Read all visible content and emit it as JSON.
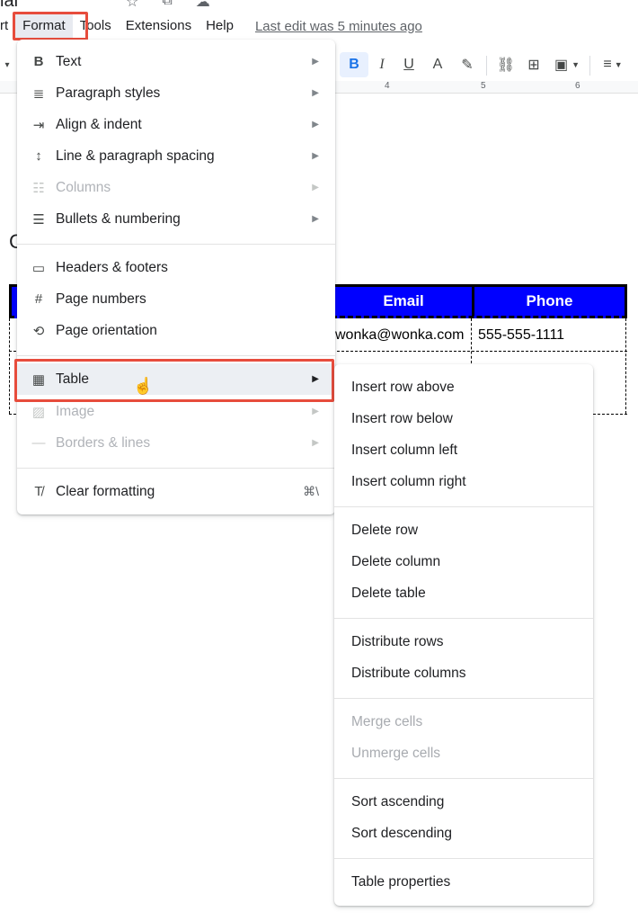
{
  "window": {
    "title_fragment": "ial",
    "title_icons": [
      "star-icon",
      "move-to-folder-icon",
      "cloud-status-icon"
    ]
  },
  "menubar": {
    "items": [
      {
        "label": "rt"
      },
      {
        "label": "Format"
      },
      {
        "label": "Tools"
      },
      {
        "label": "Extensions"
      },
      {
        "label": "Help"
      }
    ],
    "last_edit": "Last edit was 5 minutes ago"
  },
  "toolbar": {
    "bold": "B",
    "italic": "I",
    "underline": "U",
    "text_color": "A",
    "highlight": "✎",
    "link": "⛓",
    "comment": "⊞",
    "image": "▣",
    "align": "≡"
  },
  "ruler": {
    "marks": [
      "4",
      "5",
      "6"
    ]
  },
  "document": {
    "heading_fragment": "C",
    "table": {
      "headers": [
        "Email",
        "Phone"
      ],
      "rows": [
        [
          "wonka@wonka.com",
          "555-555-1111"
        ],
        [
          "",
          ""
        ]
      ]
    }
  },
  "format_menu": {
    "items": [
      {
        "label": "Text",
        "icon": "B",
        "submenu": true,
        "disabled": false
      },
      {
        "label": "Paragraph styles",
        "icon": "≣",
        "submenu": true,
        "disabled": false
      },
      {
        "label": "Align & indent",
        "icon": "⇥",
        "submenu": true,
        "disabled": false
      },
      {
        "label": "Line & paragraph spacing",
        "icon": "↕",
        "submenu": true,
        "disabled": false
      },
      {
        "label": "Columns",
        "icon": "☷",
        "submenu": true,
        "disabled": true
      },
      {
        "label": "Bullets & numbering",
        "icon": "☰",
        "submenu": true,
        "disabled": false
      },
      {
        "label": "Headers & footers",
        "icon": "▭",
        "submenu": false,
        "disabled": false
      },
      {
        "label": "Page numbers",
        "icon": "#",
        "submenu": false,
        "disabled": false
      },
      {
        "label": "Page orientation",
        "icon": "⟲",
        "submenu": false,
        "disabled": false
      },
      {
        "label": "Table",
        "icon": "▦",
        "submenu": true,
        "disabled": false,
        "active": true
      },
      {
        "label": "Image",
        "icon": "▨",
        "submenu": true,
        "disabled": true
      },
      {
        "label": "Borders & lines",
        "icon": "—",
        "submenu": true,
        "disabled": true
      },
      {
        "label": "Clear formatting",
        "icon": "T̸",
        "shortcut": "⌘\\",
        "disabled": false
      }
    ],
    "submenu_arrow": "▶"
  },
  "table_submenu": {
    "items": [
      {
        "label": "Insert row above",
        "disabled": false
      },
      {
        "label": "Insert row below",
        "disabled": false
      },
      {
        "label": "Insert column left",
        "disabled": false
      },
      {
        "label": "Insert column right",
        "disabled": false
      },
      {
        "label": "Delete row",
        "disabled": false
      },
      {
        "label": "Delete column",
        "disabled": false
      },
      {
        "label": "Delete table",
        "disabled": false
      },
      {
        "label": "Distribute rows",
        "disabled": false
      },
      {
        "label": "Distribute columns",
        "disabled": false
      },
      {
        "label": "Merge cells",
        "disabled": true
      },
      {
        "label": "Unmerge cells",
        "disabled": true
      },
      {
        "label": "Sort ascending",
        "disabled": false
      },
      {
        "label": "Sort descending",
        "disabled": false
      },
      {
        "label": "Table properties",
        "disabled": false
      }
    ]
  },
  "colors": {
    "highlight_border": "#e74c3c",
    "table_header_bg": "#0000ff",
    "bold_active": "#1a73e8"
  }
}
